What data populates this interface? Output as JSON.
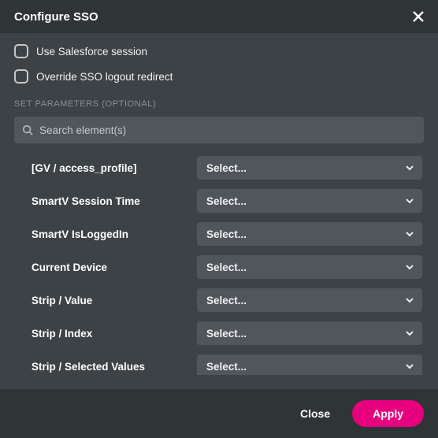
{
  "title": "Configure SSO",
  "checkboxes": [
    {
      "label": "Use Salesforce session"
    },
    {
      "label": "Override SSO logout redirect"
    }
  ],
  "section_label": "SET PARAMETERS (OPTIONAL)",
  "search": {
    "placeholder": "Search element(s)"
  },
  "select_placeholder": "Select...",
  "params": [
    {
      "label": "[GV / access_profile]"
    },
    {
      "label": "SmartV Session Time"
    },
    {
      "label": "SmartV IsLoggedIn"
    },
    {
      "label": "Current Device"
    },
    {
      "label": "Strip / Value"
    },
    {
      "label": "Strip / Index"
    },
    {
      "label": "Strip / Selected Values"
    }
  ],
  "footer": {
    "close": "Close",
    "apply": "Apply"
  }
}
